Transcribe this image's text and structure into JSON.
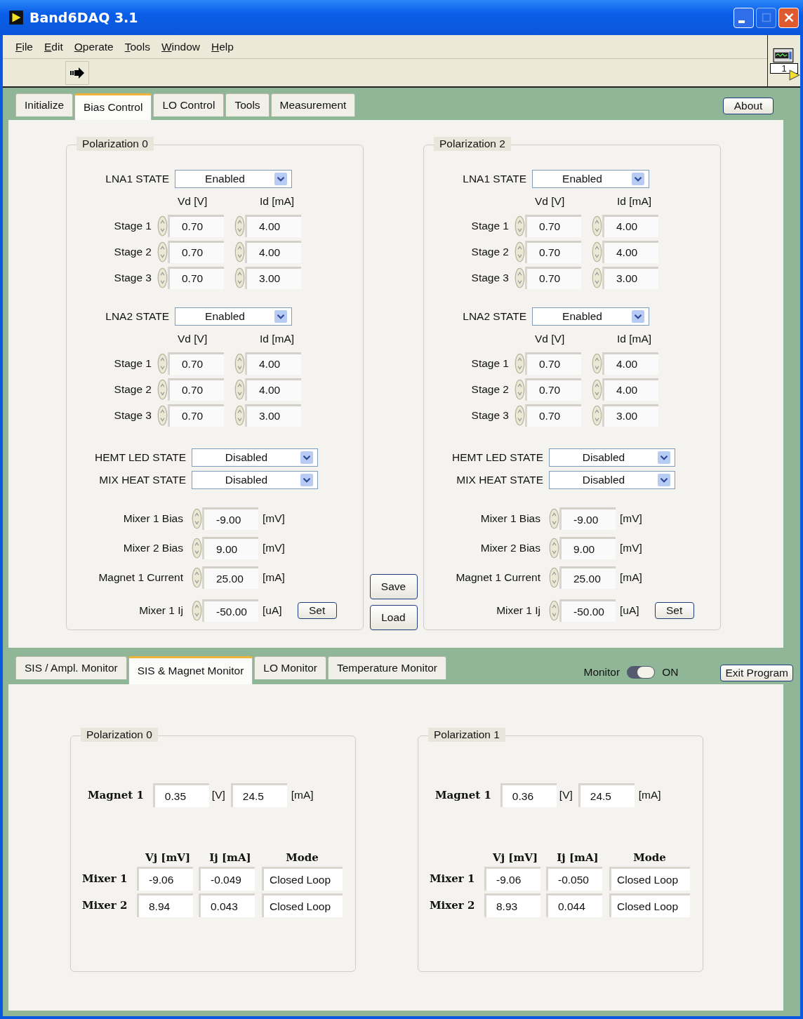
{
  "window": {
    "title": "Band6DAQ 3.1"
  },
  "menu": [
    "File",
    "Edit",
    "Operate",
    "Tools",
    "Window",
    "Help"
  ],
  "vi_icon": {
    "number": "1"
  },
  "upper_tabs": [
    {
      "label": "Initialize",
      "selected": false
    },
    {
      "label": "Bias Control",
      "selected": true
    },
    {
      "label": "LO Control",
      "selected": false
    },
    {
      "label": "Tools",
      "selected": false
    },
    {
      "label": "Measurement",
      "selected": false
    }
  ],
  "about_button": "About",
  "bias_panels": [
    {
      "title": "Polarization 0",
      "lnas": [
        {
          "label": "LNA1 STATE",
          "state": "Enabled",
          "vd_header": "Vd [V]",
          "id_header": "Id [mA]",
          "stages": [
            {
              "label": "Stage 1",
              "vd": "0.70",
              "id": "4.00"
            },
            {
              "label": "Stage 2",
              "vd": "0.70",
              "id": "4.00"
            },
            {
              "label": "Stage 3",
              "vd": "0.70",
              "id": "3.00"
            }
          ]
        },
        {
          "label": "LNA2 STATE",
          "state": "Enabled",
          "vd_header": "Vd [V]",
          "id_header": "Id [mA]",
          "stages": [
            {
              "label": "Stage 1",
              "vd": "0.70",
              "id": "4.00"
            },
            {
              "label": "Stage 2",
              "vd": "0.70",
              "id": "4.00"
            },
            {
              "label": "Stage 3",
              "vd": "0.70",
              "id": "3.00"
            }
          ]
        }
      ],
      "switches": [
        {
          "label": "HEMT LED STATE",
          "state": "Disabled"
        },
        {
          "label": "MIX HEAT STATE",
          "state": "Disabled"
        }
      ],
      "biases": [
        {
          "label": "Mixer 1 Bias",
          "value": "-9.00",
          "unit": "[mV]"
        },
        {
          "label": "Mixer 2 Bias",
          "value": "9.00",
          "unit": "[mV]"
        },
        {
          "label": "Magnet 1 Current",
          "value": "25.00",
          "unit": "[mA]"
        }
      ],
      "ij": {
        "label": "Mixer 1 Ij",
        "value": "-50.00",
        "unit": "[uA]",
        "button": "Set"
      }
    },
    {
      "title": "Polarization 2",
      "lnas": [
        {
          "label": "LNA1 STATE",
          "state": "Enabled",
          "vd_header": "Vd [V]",
          "id_header": "Id [mA]",
          "stages": [
            {
              "label": "Stage 1",
              "vd": "0.70",
              "id": "4.00"
            },
            {
              "label": "Stage 2",
              "vd": "0.70",
              "id": "4.00"
            },
            {
              "label": "Stage 3",
              "vd": "0.70",
              "id": "3.00"
            }
          ]
        },
        {
          "label": "LNA2 STATE",
          "state": "Enabled",
          "vd_header": "Vd [V]",
          "id_header": "Id [mA]",
          "stages": [
            {
              "label": "Stage 1",
              "vd": "0.70",
              "id": "4.00"
            },
            {
              "label": "Stage 2",
              "vd": "0.70",
              "id": "4.00"
            },
            {
              "label": "Stage 3",
              "vd": "0.70",
              "id": "3.00"
            }
          ]
        }
      ],
      "switches": [
        {
          "label": "HEMT LED STATE",
          "state": "Disabled"
        },
        {
          "label": "MIX HEAT STATE",
          "state": "Disabled"
        }
      ],
      "biases": [
        {
          "label": "Mixer 1 Bias",
          "value": "-9.00",
          "unit": "[mV]"
        },
        {
          "label": "Mixer 2 Bias",
          "value": "9.00",
          "unit": "[mV]"
        },
        {
          "label": "Magnet 1 Current",
          "value": "25.00",
          "unit": "[mA]"
        }
      ],
      "ij": {
        "label": "Mixer 1 Ij",
        "value": "-50.00",
        "unit": "[uA]",
        "button": "Set"
      }
    }
  ],
  "file_buttons": [
    "Save",
    "Load"
  ],
  "lower_tabs": [
    {
      "label": "SIS / Ampl. Monitor",
      "selected": false
    },
    {
      "label": "SIS & Magnet Monitor",
      "selected": true
    },
    {
      "label": "LO Monitor",
      "selected": false
    },
    {
      "label": "Temperature Monitor",
      "selected": false
    }
  ],
  "monitor": {
    "label": "Monitor",
    "on": true,
    "state_text": "ON"
  },
  "exit_button": "Exit Program",
  "monitor_panels": [
    {
      "title": "Polarization 0",
      "magnet": {
        "label": "Magnet 1",
        "voltage": "0.35",
        "voltage_unit": "[V]",
        "current": "24.5",
        "current_unit": "[mA]"
      },
      "columns": [
        "Vj [mV]",
        "Ij [mA]",
        "Mode"
      ],
      "mixers": [
        {
          "label": "Mixer 1",
          "vj": "-9.06",
          "ij": "-0.049",
          "mode": "Closed Loop"
        },
        {
          "label": "Mixer 2",
          "vj": "8.94",
          "ij": "0.043",
          "mode": "Closed Loop"
        }
      ]
    },
    {
      "title": "Polarization 1",
      "magnet": {
        "label": "Magnet 1",
        "voltage": "0.36",
        "voltage_unit": "[V]",
        "current": "24.5",
        "current_unit": "[mA]"
      },
      "columns": [
        "Vj [mV]",
        "Ij [mA]",
        "Mode"
      ],
      "mixers": [
        {
          "label": "Mixer 1",
          "vj": "-9.06",
          "ij": "-0.050",
          "mode": "Closed Loop"
        },
        {
          "label": "Mixer 2",
          "vj": "8.93",
          "ij": "0.044",
          "mode": "Closed Loop"
        }
      ]
    }
  ]
}
